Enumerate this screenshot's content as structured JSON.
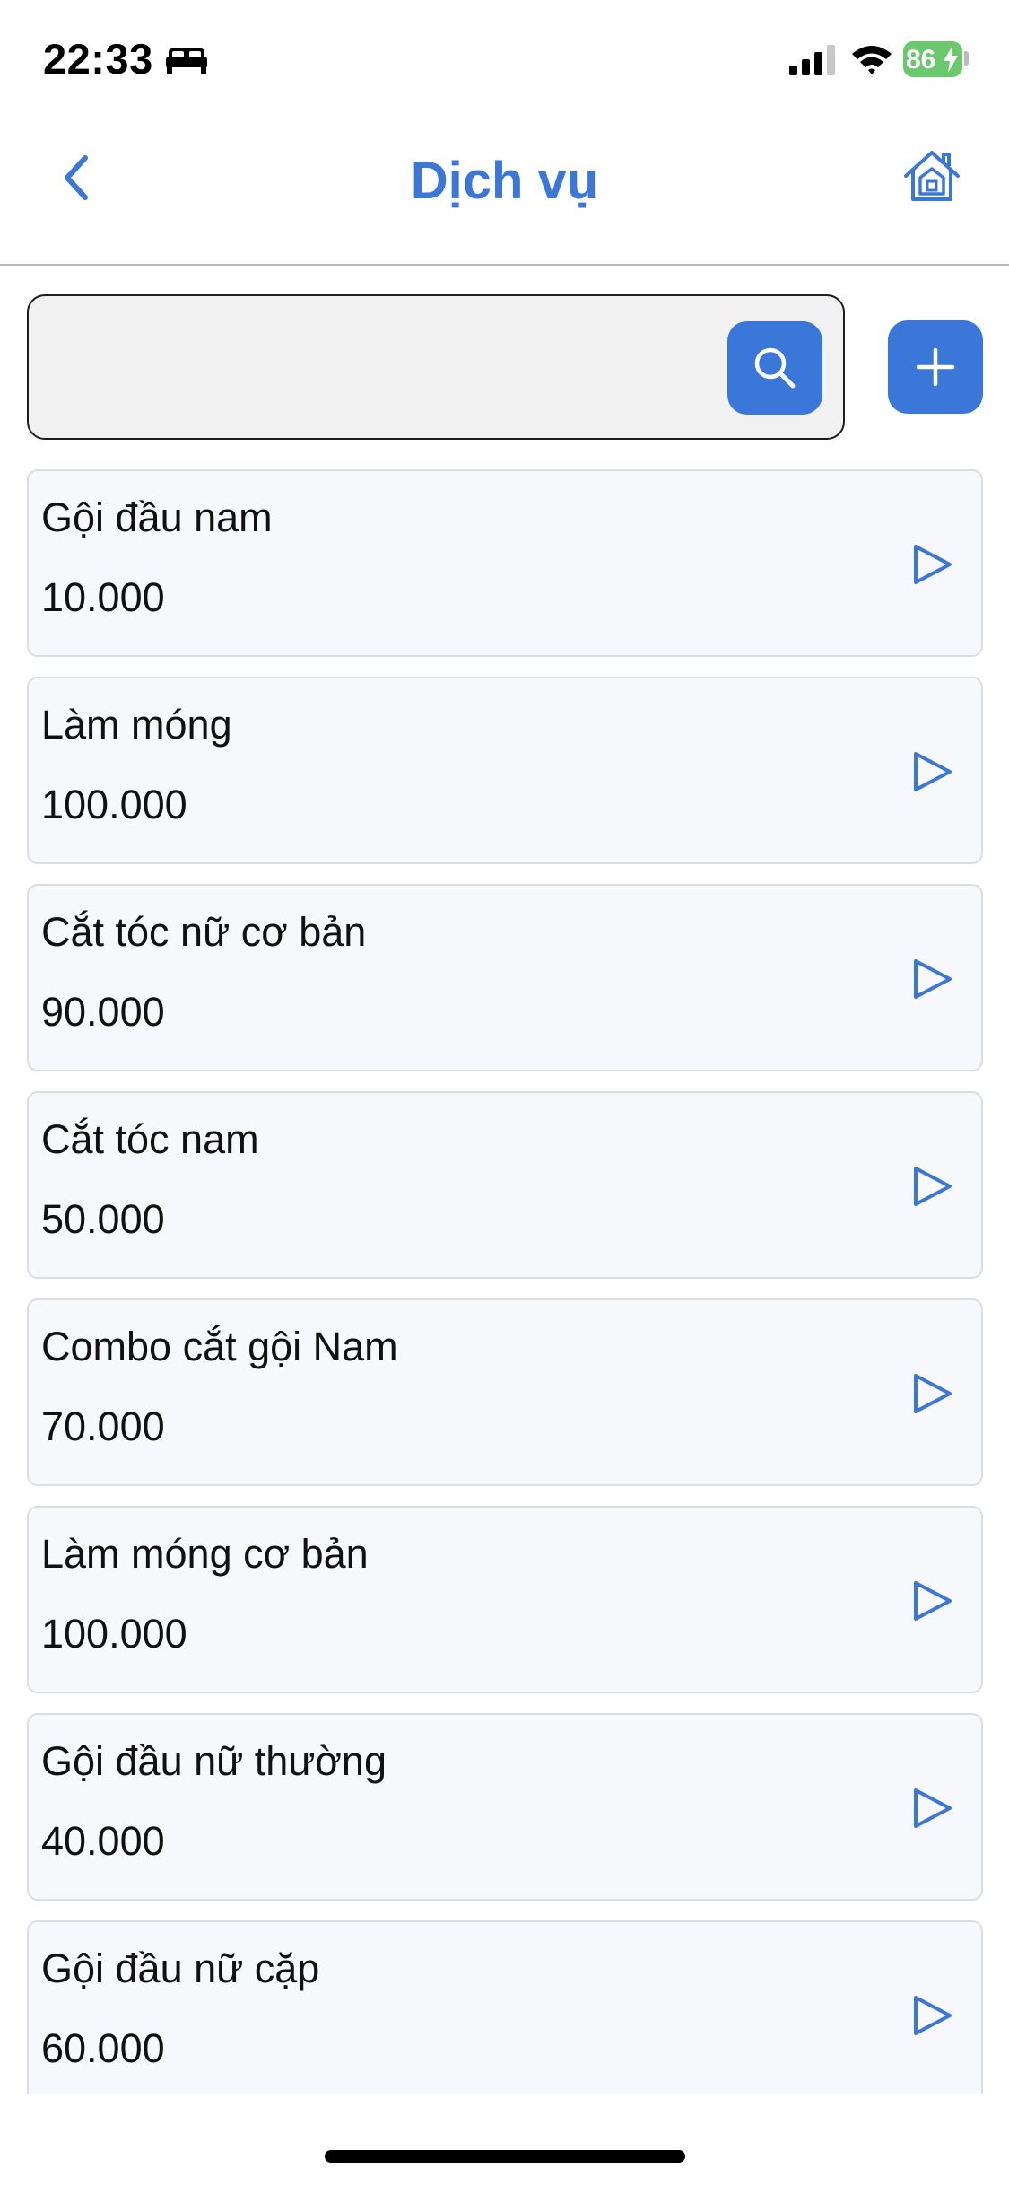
{
  "status_bar": {
    "time": "22:33",
    "battery": "86"
  },
  "nav": {
    "title": "Dịch vụ"
  },
  "search": {
    "value": "",
    "placeholder": ""
  },
  "colors": {
    "accent": "#3a77d8",
    "card_background": "#f7f8fc",
    "battery": "#6cc86d"
  },
  "icons": [
    "back-chevron-icon",
    "home-icon",
    "search-icon",
    "plus-icon",
    "play-arrow-icon"
  ],
  "services": [
    {
      "name": "Gội đầu nam",
      "price": "10.000"
    },
    {
      "name": "Làm móng",
      "price": "100.000"
    },
    {
      "name": "Cắt tóc nữ cơ bản",
      "price": "90.000"
    },
    {
      "name": "Cắt tóc nam",
      "price": "50.000"
    },
    {
      "name": "Combo cắt gội Nam",
      "price": "70.000"
    },
    {
      "name": "Làm móng cơ bản",
      "price": "100.000"
    },
    {
      "name": "Gội đầu nữ thường",
      "price": "40.000"
    },
    {
      "name": "Gội đầu nữ cặp",
      "price": "60.000"
    }
  ]
}
